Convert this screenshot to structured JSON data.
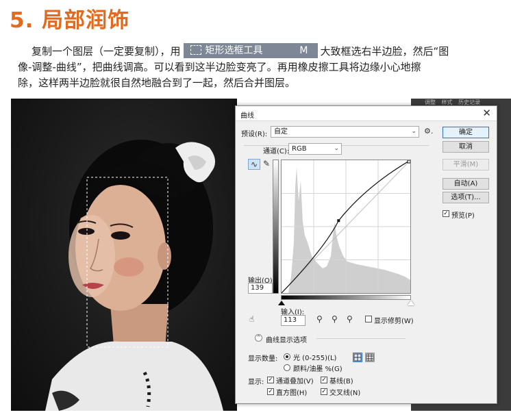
{
  "heading": "5. 局部润饰",
  "paragraph": {
    "line1_before": "复制一个图层（一定要复制），用",
    "tool_name": "矩形选框工具",
    "tool_key": "M",
    "line1_after": "大致框选右半边脸，然后“图",
    "line2": "像-调整-曲线”，把曲线调高。可以看到这半边脸变亮了。再用橡皮擦工具将边缘小心地擦",
    "line3": "除，这样两半边脸就很自然地融合到了一起，然后合并图层。"
  },
  "ps_panel_tabs": [
    "调整",
    "样式",
    "历史记录"
  ],
  "dialog": {
    "title": "曲线",
    "preset_label": "预设(R):",
    "preset_value": "自定",
    "channel_label": "通道(C):",
    "channel_value": "RGB",
    "buttons": {
      "ok": "确定",
      "cancel": "取消",
      "smooth": "平滑(M)",
      "auto": "自动(A)",
      "options": "选项(T)..."
    },
    "preview_label": "预览(P)",
    "preview_checked": true,
    "output_label": "输出(O):",
    "output_value": "139",
    "input_label": "输入(I):",
    "input_value": "113",
    "show_clipping_label": "显示修剪(W)",
    "curve_display_label": "曲线显示选项",
    "display_amount_label": "显示数量:",
    "light_option": "光 (0-255)(L)",
    "pigment_option": "颜料/油墨 %(G)",
    "show_label": "显示:",
    "show_options": {
      "channel_overlays": "通道叠加(V)",
      "baseline": "基线(B)",
      "histogram": "直方图(H)",
      "intersection_line": "交叉线(N)"
    },
    "curve_point": {
      "input": 113,
      "output": 139
    }
  },
  "colors": {
    "heading": "#e36a1d",
    "tool_badge": "#7e8796",
    "default_button_border": "#2b73c8"
  },
  "icons": [
    "close-icon",
    "gear-icon",
    "curve-edit-icon",
    "pencil-icon",
    "hand-target-icon",
    "black-eyedropper-icon",
    "gray-eyedropper-icon",
    "white-eyedropper-icon",
    "expand-icon",
    "grid-simple-icon",
    "grid-detailed-icon",
    "marquee-icon"
  ]
}
